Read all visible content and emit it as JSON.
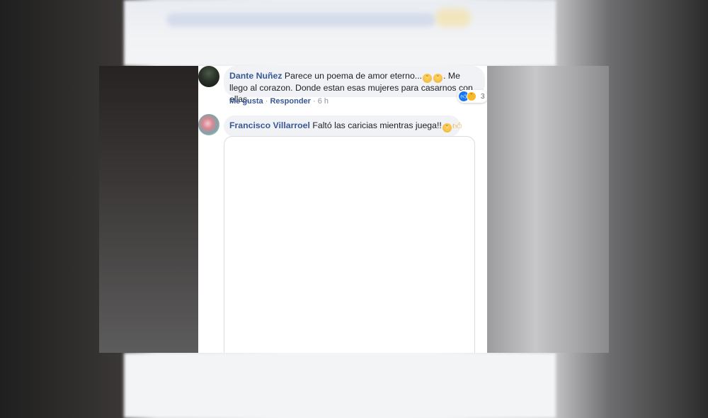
{
  "comments": [
    {
      "author": "Dante Nuñez",
      "text_part1": "Parece un poema de amor eterno...",
      "text_part2": ". Me llego al corazon. Donde estan esas mujeres para casarnos con ellas.",
      "actions": {
        "like": "Me gusta",
        "reply": "Responder",
        "time": "6 h"
      },
      "reactions": {
        "count": "3",
        "types": [
          "like-icon",
          "haha-icon"
        ]
      }
    },
    {
      "author": "Francisco Villarroel",
      "text": "Faltó las caricias mientras juega!!"
    }
  ],
  "icons": {
    "like": "like-icon",
    "haha": "haha-icon",
    "emoji": "emoji-icon",
    "thumbs_up": "thumbs-up-icon"
  },
  "colors": {
    "author": "#385898",
    "bubble": "#f0f2f5",
    "like_blue": "#1877f2"
  }
}
